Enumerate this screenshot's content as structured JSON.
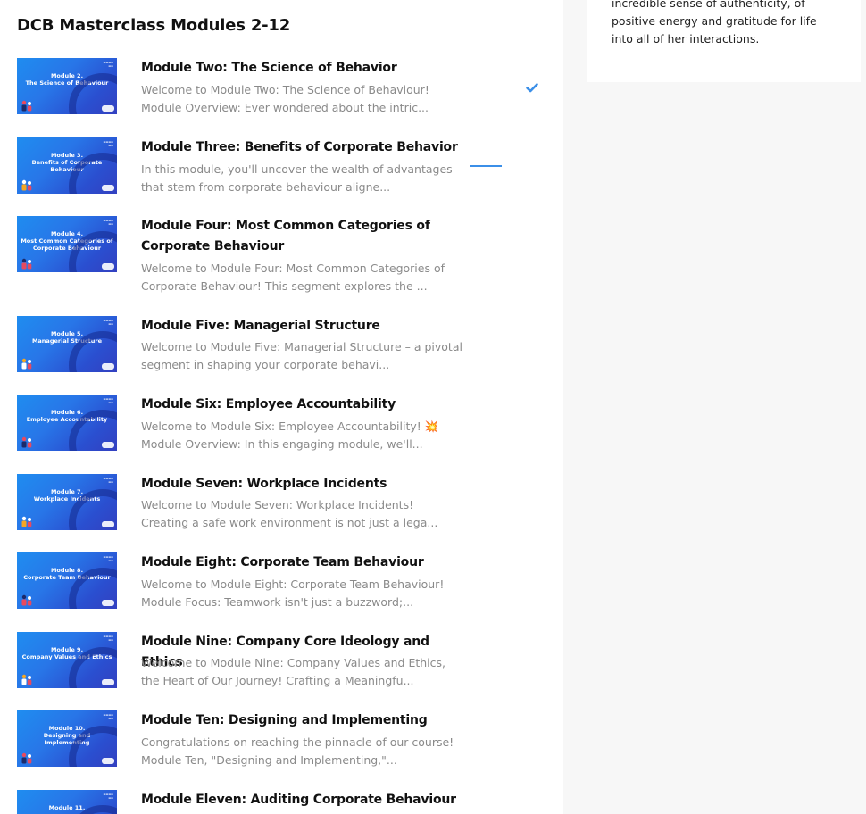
{
  "course": {
    "title": "DCB Masterclass Modules 2-12"
  },
  "sidebar": {
    "text": "incredible sense of authenticity, of positive energy and gratitude for life into all of her interactions."
  },
  "modules": [
    {
      "title": "Module Two: The Science of Behavior",
      "description": "Welcome to Module Two: The Science of Behaviour! Module Overview: Ever wondered about the intric...",
      "thumb": "Module 2.\nThe Science of Behaviour",
      "status": "completed"
    },
    {
      "title": "Module Three: Benefits of Corporate Behavior",
      "description": "In this module, you'll uncover the wealth of advantages that stem from corporate behaviour aligne...",
      "thumb": "Module 3.\nBenefits of Corporate Behaviour",
      "status": "in-progress"
    },
    {
      "title": "Module Four: Most Common Categories of Corporate Behaviour",
      "description": "Welcome to Module Four: Most Common Categories of Corporate Behaviour! This segment explores the ...",
      "thumb": "Module 4.\nMost Common Categories of Corporate Behaviour",
      "status": "none"
    },
    {
      "title": "Module Five: Managerial Structure",
      "description": "Welcome to Module Five: Managerial Structure – a pivotal segment in shaping your corporate behavi...",
      "thumb": "Module 5.\nManagerial Structure",
      "status": "none"
    },
    {
      "title": "Module Six: Employee Accountability",
      "description": "Welcome to Module Six: Employee Accountability! 💥 Module Overview: In this engaging module, we'll...",
      "thumb": "Module 6.\nEmployee Accountability",
      "status": "none"
    },
    {
      "title": "Module Seven: Workplace Incidents",
      "description": "Welcome to Module Seven: Workplace Incidents! Creating a safe work environment is not just a lega...",
      "thumb": "Module 7.\nWorkplace Incidents",
      "status": "none"
    },
    {
      "title": "Module Eight: Corporate Team Behaviour",
      "description": "Welcome to Module Eight: Corporate Team Behaviour! Module Focus: Teamwork isn't just a buzzword;...",
      "thumb": "Module 8.\nCorporate Team Behaviour",
      "status": "none"
    },
    {
      "title": "Module Nine: Company Core Ideology and Ethics",
      "description": "Welcome to Module Nine: Company Values and Ethics, the Heart of Our Journey! Crafting a Meaningfu...",
      "thumb": "Module 9.\nCompany Values and Ethics",
      "status": "none"
    },
    {
      "title": "Module Ten: Designing and Implementing",
      "description": "Congratulations on reaching the pinnacle of our course! Module Ten, \"Designing and Implementing,\"...",
      "thumb": "Module 10.\nDesigning and Implementing",
      "status": "none"
    },
    {
      "title": "Module Eleven: Auditing Corporate Behaviour",
      "description": "",
      "thumb": "Module 11.",
      "status": "none"
    }
  ],
  "colors": {
    "accent": "#3b8fe8",
    "thumbBlue": "#2876e8",
    "mutedText": "#8a8a8a"
  }
}
